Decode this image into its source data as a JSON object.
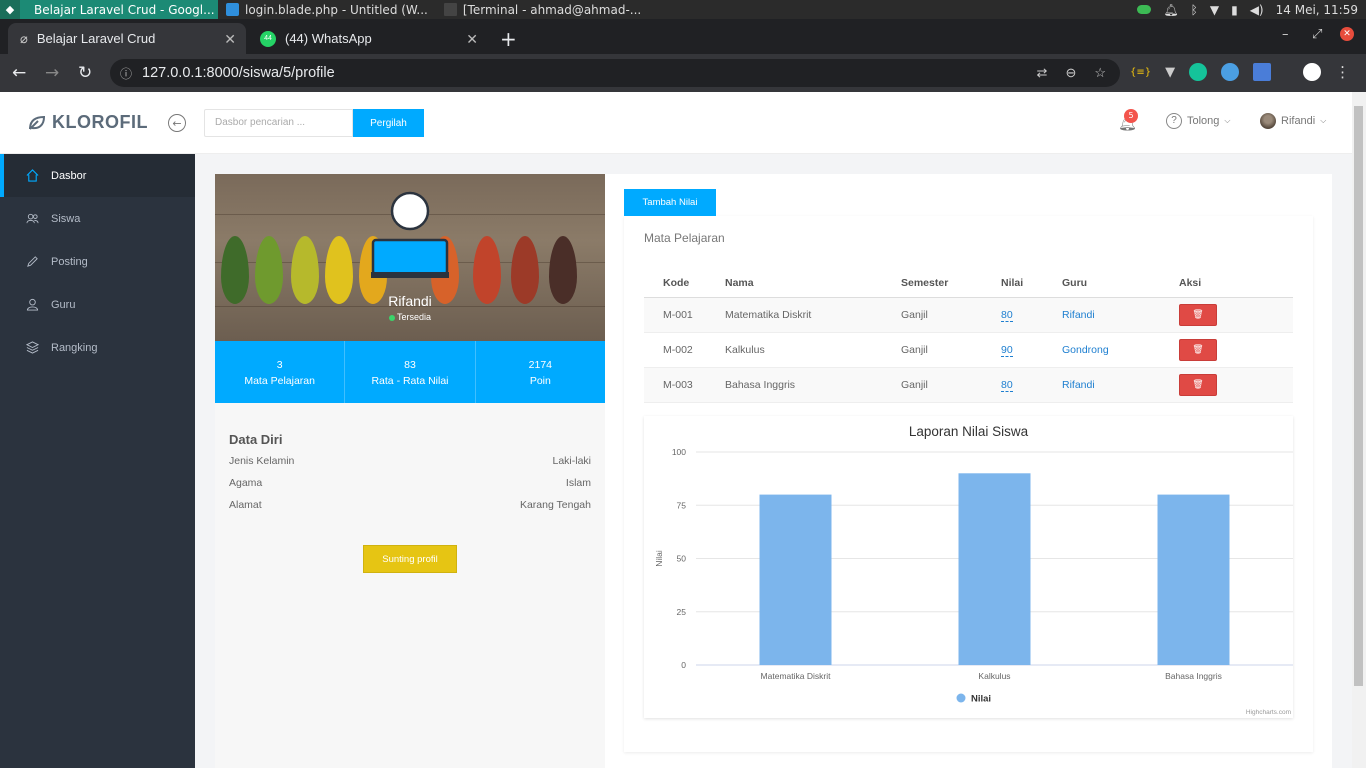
{
  "os": {
    "tasks": [
      {
        "label": "Belajar Laravel Crud - Googl...",
        "active": true
      },
      {
        "label": "login.blade.php - Untitled (W...",
        "active": false
      },
      {
        "label": "[Terminal - ahmad@ahmad-...",
        "active": false
      }
    ],
    "clock": "14 Mei, 11:59"
  },
  "browser": {
    "tabs": [
      {
        "label": "Belajar Laravel Crud",
        "close": "✕"
      },
      {
        "label": "(44) WhatsApp",
        "close": "✕",
        "badge": "44"
      }
    ],
    "new_tab": "+",
    "url": "127.0.0.1:8000/siswa/5/profile"
  },
  "header": {
    "brand": "KLOROFIL",
    "search_placeholder": "Dasbor pencarian ...",
    "search_button": "Pergilah",
    "notif_count": "5",
    "help_label": "Tolong",
    "user_label": "Rifandi"
  },
  "sidebar": {
    "items": [
      {
        "label": "Dasbor",
        "icon": "home-icon",
        "active": true
      },
      {
        "label": "Siswa",
        "icon": "users-icon",
        "active": false
      },
      {
        "label": "Posting",
        "icon": "pencil-icon",
        "active": false
      },
      {
        "label": "Guru",
        "icon": "user-icon",
        "active": false
      },
      {
        "label": "Rangking",
        "icon": "rank-icon",
        "active": false
      }
    ]
  },
  "profile": {
    "name": "Rifandi",
    "status": "Tersedia",
    "stats": [
      {
        "value": "3",
        "label": "Mata Pelajaran"
      },
      {
        "value": "83",
        "label": "Rata - Rata Nilai"
      },
      {
        "value": "2174",
        "label": "Poin"
      }
    ],
    "data_diri_title": "Data Diri",
    "fields": [
      {
        "label": "Jenis Kelamin",
        "value": "Laki-laki"
      },
      {
        "label": "Agama",
        "value": "Islam"
      },
      {
        "label": "Alamat",
        "value": "Karang Tengah"
      }
    ],
    "edit_button": "Sunting profil"
  },
  "subjects": {
    "add_button": "Tambah Nilai",
    "title": "Mata Pelajaran",
    "columns": [
      "Kode",
      "Nama",
      "Semester",
      "Nilai",
      "Guru",
      "Aksi"
    ],
    "rows": [
      {
        "kode": "M-001",
        "nama": "Matematika Diskrit",
        "semester": "Ganjil",
        "nilai": "80",
        "guru": "Rifandi"
      },
      {
        "kode": "M-002",
        "nama": "Kalkulus",
        "semester": "Ganjil",
        "nilai": "90",
        "guru": "Gondrong"
      },
      {
        "kode": "M-003",
        "nama": "Bahasa Inggris",
        "semester": "Ganjil",
        "nilai": "80",
        "guru": "Rifandi"
      }
    ]
  },
  "colors": {
    "accent": "#00aaff",
    "sidebar_bg": "#2b333e",
    "danger": "#e04a45",
    "warning": "#e6c513",
    "bar": "#7cb5ec"
  },
  "chart_data": {
    "type": "bar",
    "title": "Laporan Nilai Siswa",
    "categories": [
      "Matematika Diskrit",
      "Kalkulus",
      "Bahasa Inggris"
    ],
    "series": [
      {
        "name": "Nilai",
        "values": [
          80,
          90,
          80
        ]
      }
    ],
    "ylabel": "Nilai",
    "xlabel": "",
    "ylim": [
      0,
      100
    ],
    "yticks": [
      0,
      25,
      50,
      75,
      100
    ],
    "grid": true,
    "legend": "bottom-center",
    "credits": "Highcharts.com"
  }
}
